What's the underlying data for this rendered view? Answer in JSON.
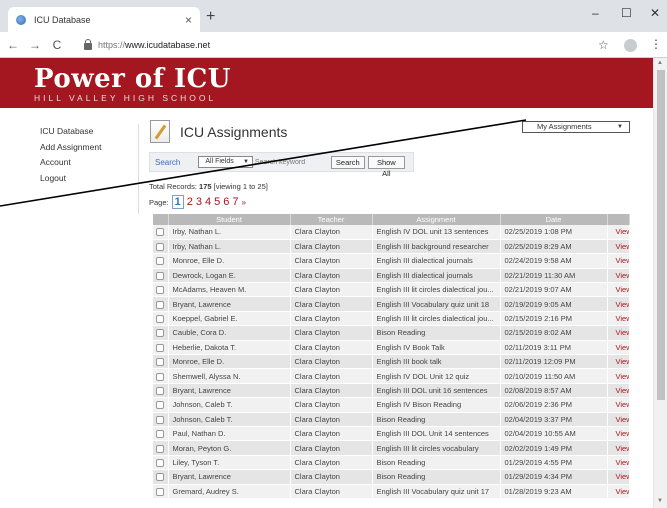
{
  "browser": {
    "tab_title": "ICU Database",
    "tab_close": "×",
    "new_tab": "+",
    "minimize": "–",
    "maximize": "☐",
    "close": "✕",
    "back": "←",
    "forward": "→",
    "reload": "C",
    "url_scheme": "https://",
    "url_host": "www.icudatabase.net",
    "bookmark": "☆",
    "menu": "⋮"
  },
  "banner": {
    "title": "Power of ICU",
    "subtitle": "HILL VALLEY HIGH SCHOOL",
    "color": "#a41620"
  },
  "nav": {
    "items": [
      "ICU Database",
      "Add Assignment",
      "Account",
      "Logout"
    ]
  },
  "main": {
    "title": "ICU Assignments",
    "filter_select": "My Assignments",
    "search_label": "Search",
    "search_field_select": "All Fields",
    "search_placeholder": "Search keyword",
    "search_button": "Search",
    "show_all_button": "Show All",
    "records_prefix": "Total Records:",
    "records_count": "175",
    "records_range": "[viewing 1 to 25]",
    "page_label": "Page:",
    "current_page": "1",
    "pages": [
      "2",
      "3",
      "4",
      "5",
      "6",
      "7"
    ],
    "next_label": "»"
  },
  "table": {
    "headers": [
      "",
      "Student",
      "Teacher",
      "Assignment",
      "Date",
      ""
    ],
    "view_label": "View",
    "rows": [
      {
        "student": "Irby, Nathan L.",
        "teacher": "Clara Clayton",
        "assignment": "English IV DOL unit 13 sentences",
        "date": "02/25/2019 1:08 PM"
      },
      {
        "student": "Irby, Nathan L.",
        "teacher": "Clara Clayton",
        "assignment": "English III background researcher",
        "date": "02/25/2019 8:29 AM"
      },
      {
        "student": "Monroe, Elle D.",
        "teacher": "Clara Clayton",
        "assignment": "English III dialectical journals",
        "date": "02/24/2019 9:58 AM"
      },
      {
        "student": "Dewrock, Logan E.",
        "teacher": "Clara Clayton",
        "assignment": "English III dialectical journals",
        "date": "02/21/2019 11:30 AM"
      },
      {
        "student": "McAdams, Heaven M.",
        "teacher": "Clara Clayton",
        "assignment": "English III lit circles dialectical jou...",
        "date": "02/21/2019 9:07 AM"
      },
      {
        "student": "Bryant, Lawrence",
        "teacher": "Clara Clayton",
        "assignment": "English III Vocabulary quiz unit 18",
        "date": "02/19/2019 9:05 AM"
      },
      {
        "student": "Koeppel, Gabriel E.",
        "teacher": "Clara Clayton",
        "assignment": "English III lit circles dialectical jou...",
        "date": "02/15/2019 2:16 PM"
      },
      {
        "student": "Cauble, Cora D.",
        "teacher": "Clara Clayton",
        "assignment": "Bison Reading",
        "date": "02/15/2019 8:02 AM"
      },
      {
        "student": "Heberlie, Dakota T.",
        "teacher": "Clara Clayton",
        "assignment": "English IV Book Talk",
        "date": "02/11/2019 3:11 PM"
      },
      {
        "student": "Monroe, Elle D.",
        "teacher": "Clara Clayton",
        "assignment": "English III book talk",
        "date": "02/11/2019 12:09 PM"
      },
      {
        "student": "Shemwell, Alyssa N.",
        "teacher": "Clara Clayton",
        "assignment": "English IV DOL Unit 12 quiz",
        "date": "02/10/2019 11:50 AM"
      },
      {
        "student": "Bryant, Lawrence",
        "teacher": "Clara Clayton",
        "assignment": "English III DOL unit 16 sentences",
        "date": "02/08/2019 8:57 AM"
      },
      {
        "student": "Johnson, Caleb T.",
        "teacher": "Clara Clayton",
        "assignment": "English IV Bison Reading",
        "date": "02/06/2019 2:36 PM"
      },
      {
        "student": "Johnson, Caleb T.",
        "teacher": "Clara Clayton",
        "assignment": "Bison Reading",
        "date": "02/04/2019 3:37 PM"
      },
      {
        "student": "Paul, Nathan D.",
        "teacher": "Clara Clayton",
        "assignment": "English III DOL Unit 14 sentences",
        "date": "02/04/2019 10:55 AM"
      },
      {
        "student": "Moran, Peyton G.",
        "teacher": "Clara Clayton",
        "assignment": "English III lit circles vocabulary",
        "date": "02/02/2019 1:49 PM"
      },
      {
        "student": "Liley, Tyson T.",
        "teacher": "Clara Clayton",
        "assignment": "Bison Reading",
        "date": "01/29/2019 4:55 PM"
      },
      {
        "student": "Bryant, Lawrence",
        "teacher": "Clara Clayton",
        "assignment": "Bison Reading",
        "date": "01/29/2019 4:34 PM"
      },
      {
        "student": "Gremard, Audrey S.",
        "teacher": "Clara Clayton",
        "assignment": "English III Vocabulary quiz unit 17",
        "date": "01/28/2019 9:23 AM"
      }
    ]
  }
}
